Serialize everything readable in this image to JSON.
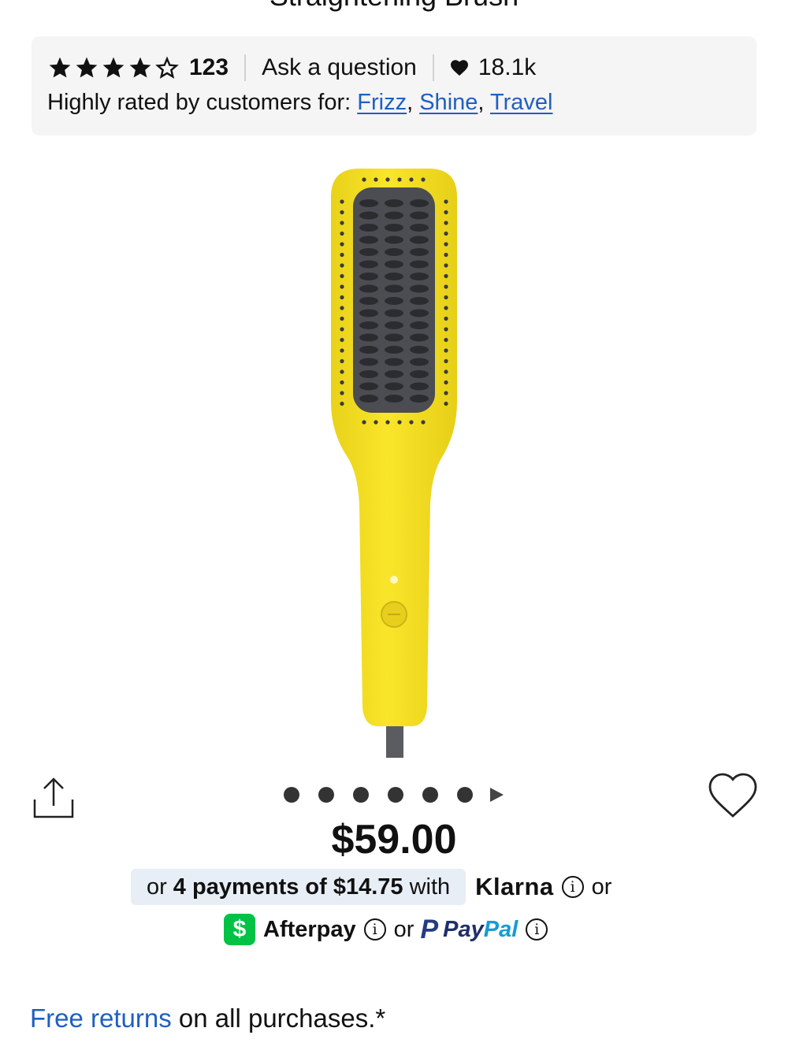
{
  "header": {
    "product_title": "Straightening Brush"
  },
  "rating": {
    "stars": 4,
    "max_stars": 5,
    "review_count": "123",
    "ask_label": "Ask a question",
    "loves_count": "18.1k"
  },
  "highly_rated": {
    "label": "Highly rated by customers for:",
    "tags": [
      "Frizz",
      "Shine",
      "Travel"
    ]
  },
  "gallery": {
    "total_images": 6,
    "active_index": 0
  },
  "price": {
    "amount": "$59.00"
  },
  "payments": {
    "prefix": "or",
    "installments": "4 payments of $14.75",
    "with": "with",
    "klarna": "Klarna",
    "or1": "or",
    "afterpay": "Afterpay",
    "or2": "or",
    "paypal_pay": "Pay",
    "paypal_pal": "Pal"
  },
  "returns": {
    "link": "Free returns",
    "text": "on all purchases.*"
  },
  "colors": {
    "link": "#1f5fc1",
    "product_yellow": "#f7e224",
    "brush_pad": "#4b4d52",
    "cashapp_green": "#00c244",
    "klarna_bg": "#e8eef6"
  }
}
